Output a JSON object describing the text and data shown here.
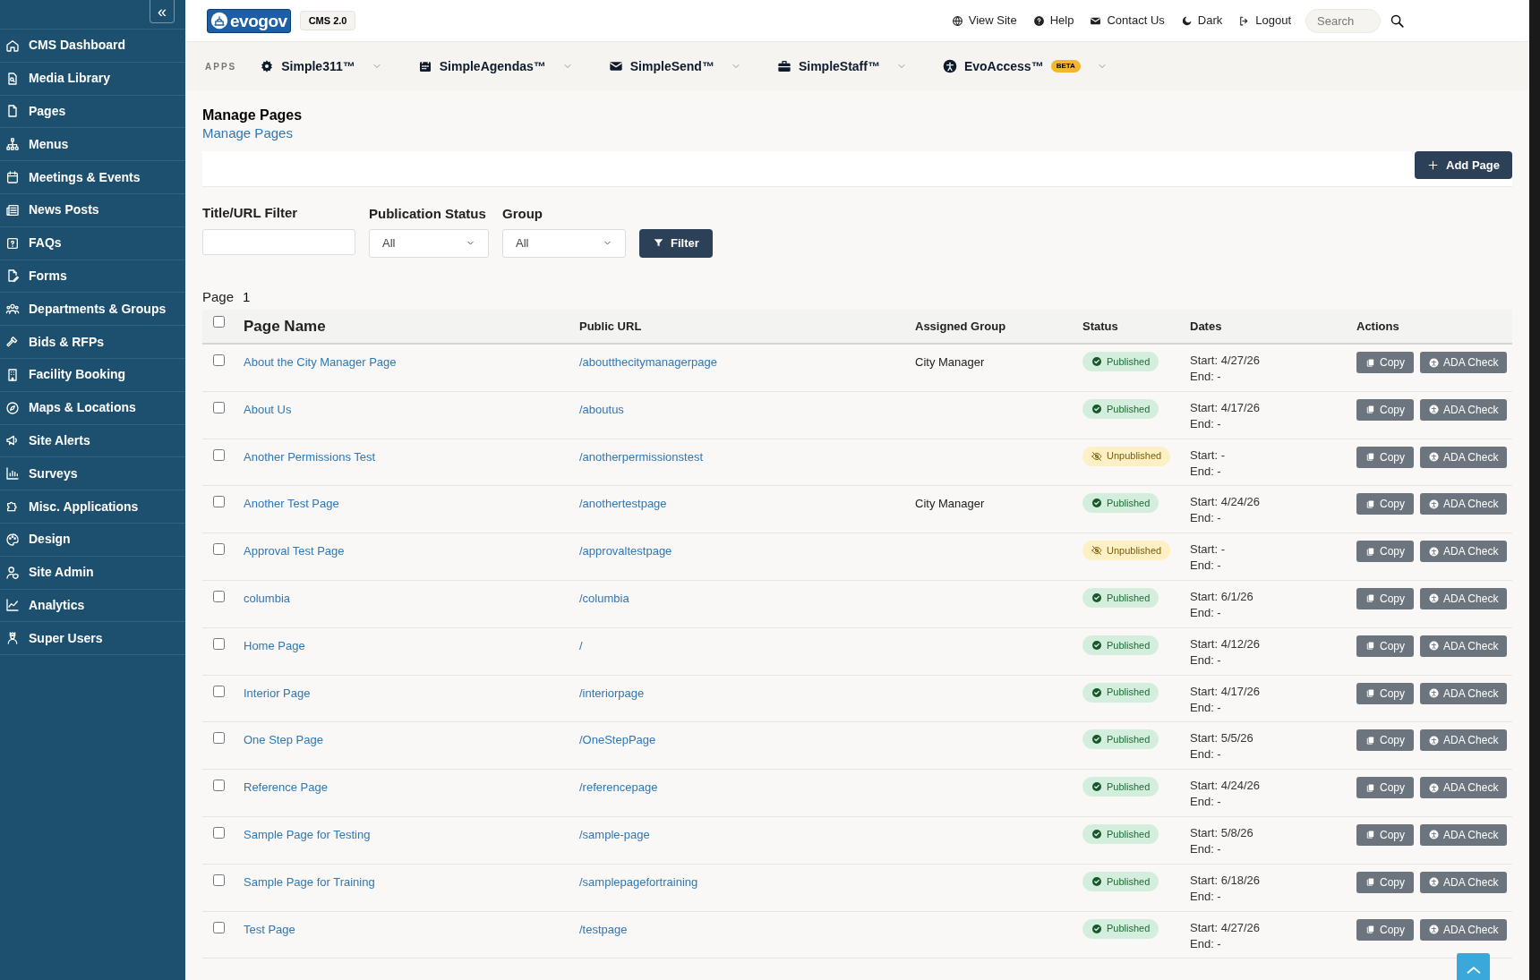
{
  "sidebar": {
    "collapse_icon": "«",
    "items": [
      {
        "label": "CMS Dashboard"
      },
      {
        "label": "Media Library"
      },
      {
        "label": "Pages"
      },
      {
        "label": "Menus"
      },
      {
        "label": "Meetings & Events"
      },
      {
        "label": "News Posts"
      },
      {
        "label": "FAQs"
      },
      {
        "label": "Forms"
      },
      {
        "label": "Departments & Groups"
      },
      {
        "label": "Bids & RFPs"
      },
      {
        "label": "Facility Booking"
      },
      {
        "label": "Maps & Locations"
      },
      {
        "label": "Site Alerts"
      },
      {
        "label": "Surveys"
      },
      {
        "label": "Misc. Applications"
      },
      {
        "label": "Design"
      },
      {
        "label": "Site Admin"
      },
      {
        "label": "Analytics"
      },
      {
        "label": "Super Users"
      }
    ]
  },
  "header": {
    "logo": "evogov",
    "version_badge": "CMS 2.0",
    "links": [
      {
        "label": "View Site"
      },
      {
        "label": "Help"
      },
      {
        "label": "Contact Us"
      },
      {
        "label": "Dark"
      },
      {
        "label": "Logout"
      }
    ],
    "search": {
      "placeholder": "Search"
    }
  },
  "apps_bar": {
    "label": "APPS",
    "apps": [
      {
        "label": "Simple311™"
      },
      {
        "label": "SimpleAgendas™"
      },
      {
        "label": "SimpleSend™"
      },
      {
        "label": "SimpleStaff™"
      },
      {
        "label": "EvoAccess™",
        "badge": "BETA"
      }
    ]
  },
  "page": {
    "title": "Manage Pages",
    "breadcrumb": "Manage Pages",
    "add_button": "Add Page"
  },
  "filters": {
    "title_filter": {
      "label": "Title/URL Filter"
    },
    "status": {
      "label": "Publication Status",
      "value": "All"
    },
    "group": {
      "label": "Group",
      "value": "All"
    },
    "button": "Filter"
  },
  "pagination": {
    "label": "Page",
    "current": "1"
  },
  "table": {
    "select_all": {
      "checked": false
    },
    "columns": [
      "Page Name",
      "Public URL",
      "Assigned Group",
      "Status",
      "Dates",
      "Actions"
    ],
    "rows": [
      {
        "checked": false,
        "name": "About the City Manager Page",
        "url": "/aboutthecitymanagerpage",
        "group": "City Manager",
        "status": "Published",
        "kind": "published",
        "start": "Start: 4/27/26",
        "end": "End: -",
        "actions": [
          "Copy",
          "ADA Check"
        ]
      },
      {
        "checked": false,
        "name": "About Us",
        "url": "/aboutus",
        "status": "Published",
        "kind": "published",
        "start": "Start: 4/17/26",
        "end": "End: -",
        "actions": [
          "Copy",
          "ADA Check"
        ]
      },
      {
        "checked": false,
        "name": "Another Permissions Test",
        "url": "/anotherpermissionstest",
        "status": "Unpublished",
        "kind": "unpublished",
        "start": "Start: -",
        "end": "End: -",
        "actions": [
          "Copy",
          "ADA Check"
        ]
      },
      {
        "checked": false,
        "name": "Another Test Page",
        "url": "/anothertestpage",
        "group": "City Manager",
        "status": "Published",
        "kind": "published",
        "start": "Start: 4/24/26",
        "end": "End: -",
        "actions": [
          "Copy",
          "ADA Check"
        ]
      },
      {
        "checked": false,
        "name": "Approval Test Page",
        "url": "/approvaltestpage",
        "status": "Unpublished",
        "kind": "unpublished",
        "start": "Start: -",
        "end": "End: -",
        "actions": [
          "Copy",
          "ADA Check"
        ]
      },
      {
        "checked": false,
        "name": "columbia",
        "url": "/columbia",
        "status": "Published",
        "kind": "published",
        "start": "Start: 6/1/26",
        "end": "End: -",
        "actions": [
          "Copy",
          "ADA Check"
        ]
      },
      {
        "checked": false,
        "name": "Home Page",
        "url": "/",
        "status": "Published",
        "kind": "published",
        "start": "Start: 4/12/26",
        "end": "End: -",
        "actions": [
          "Copy",
          "ADA Check"
        ]
      },
      {
        "checked": false,
        "name": "Interior Page",
        "url": "/interiorpage",
        "status": "Published",
        "kind": "published",
        "start": "Start: 4/17/26",
        "end": "End: -",
        "actions": [
          "Copy",
          "ADA Check"
        ]
      },
      {
        "checked": false,
        "name": "One Step Page",
        "url": "/OneStepPage",
        "status": "Published",
        "kind": "published",
        "start": "Start: 5/5/26",
        "end": "End: -",
        "actions": [
          "Copy",
          "ADA Check"
        ]
      },
      {
        "checked": false,
        "name": "Reference Page",
        "url": "/referencepage",
        "status": "Published",
        "kind": "published",
        "start": "Start: 4/24/26",
        "end": "End: -",
        "actions": [
          "Copy",
          "ADA Check"
        ]
      },
      {
        "checked": false,
        "name": "Sample Page for Testing",
        "url": "/sample-page",
        "status": "Published",
        "kind": "published",
        "start": "Start: 5/8/26",
        "end": "End: -",
        "actions": [
          "Copy",
          "ADA Check"
        ]
      },
      {
        "checked": false,
        "name": "Sample Page for Training",
        "url": "/samplepagefortraining",
        "status": "Published",
        "kind": "published",
        "start": "Start: 6/18/26",
        "end": "End: -",
        "actions": [
          "Copy",
          "ADA Check"
        ]
      },
      {
        "checked": false,
        "name": "Test Page",
        "url": "/testpage",
        "status": "Published",
        "kind": "published",
        "start": "Start: 4/27/26",
        "end": "End: -",
        "actions": [
          "Copy",
          "ADA Check"
        ]
      }
    ]
  }
}
